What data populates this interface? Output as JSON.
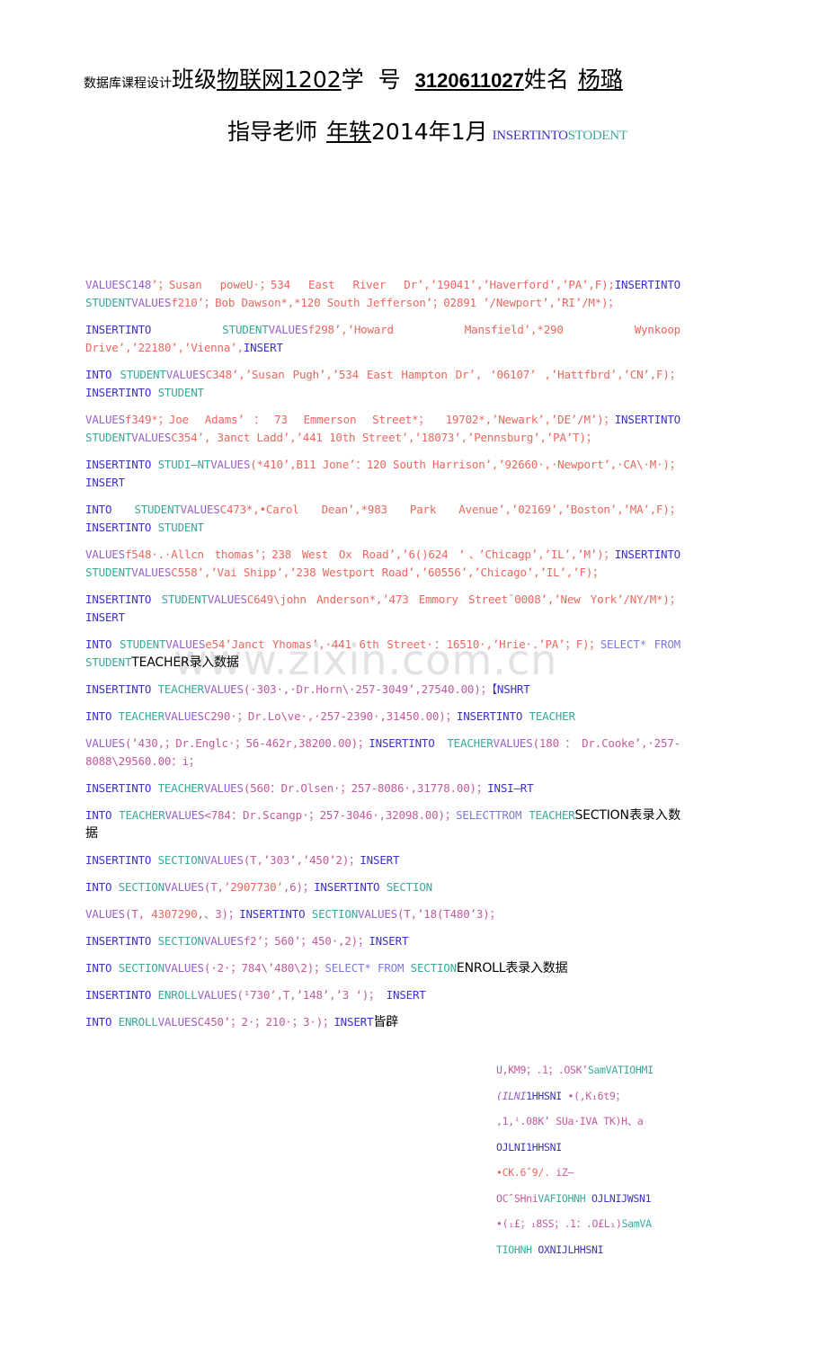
{
  "document": {
    "watermark": "www.zixin.com.cn",
    "colors": {
      "insert_keyword": "#3a33c4",
      "table_name": "#3aa89a",
      "values_keyword": "#9a5fc7",
      "student_data": "#e8685f",
      "teacher_data": "#c15a9e",
      "select_keyword": "#7b7bd8",
      "chinese_text": "#000000",
      "watermark": "#e2e2e6"
    }
  },
  "header": {
    "course_label": "数据库课程设计",
    "class_label": "班级",
    "class_value": "物联网1202",
    "student_id_label_1": "学",
    "student_id_label_2": "号",
    "student_id_value": "3120611027",
    "name_label": "姓名",
    "name_value": "杨璐",
    "advisor_label": "指导老师",
    "advisor_value": "年轶",
    "date_value": "2014年1月",
    "trailing_text": "INSERT INTO STODENT"
  },
  "sql_lines": [
    {
      "id": "line-1",
      "segments": [
        {
          "text": "VALUESC148",
          "style": "val"
        },
        {
          "text": "’；Susan poweU·；534 East River Dr’,’19041’,’Haverford’,’PA’,F)",
          "style": "dat"
        },
        {
          "text": ";",
          "style": "dat"
        },
        {
          "text": "INSERTINTO",
          "style": "ins"
        },
        {
          "text": " ",
          "style": "plain"
        },
        {
          "text": "STUDENT",
          "style": "tbl"
        },
        {
          "text": "VALUES",
          "style": "val"
        },
        {
          "text": "f210’；Bob Dawson*,*120 South Jefferson’；02891 ’/Newport’,’RI’/M*)；",
          "style": "dat"
        }
      ]
    },
    {
      "id": "line-2",
      "segments": [
        {
          "text": "INSERTINTO",
          "style": "ins"
        },
        {
          "text": "            ",
          "style": "plain"
        },
        {
          "text": "STUDENT",
          "style": "tbl"
        },
        {
          "text": "VALUES",
          "style": "val"
        },
        {
          "text": "f298’,’Howard          Mansfield’,*290        Wynkoop Drive’,’22180’,’Vienna’,",
          "style": "dat"
        },
        {
          "text": "INSERT",
          "style": "ins"
        }
      ]
    },
    {
      "id": "line-3",
      "segments": [
        {
          "text": "INTO",
          "style": "ins"
        },
        {
          "text": "          ",
          "style": "plain"
        },
        {
          "text": "STUDENT",
          "style": "tbl"
        },
        {
          "text": "VALUES",
          "style": "val"
        },
        {
          "text": "C348’,’Susan          Pugh’,’534        East        Hampton Dr’, ‘06107’ ,’Hattfbrd’,’CN’,F)；",
          "style": "dat"
        },
        {
          "text": "INSERTINTO",
          "style": "ins"
        },
        {
          "text": " ",
          "style": "plain"
        },
        {
          "text": "STUDENT",
          "style": "tbl"
        }
      ]
    },
    {
      "id": "line-4",
      "segments": [
        {
          "text": "VALUES",
          "style": "val"
        },
        {
          "text": "f349*；Joe Adams’：73 Emmerson Street*； 19702*,’Newark’,’DE’/M’)；",
          "style": "dat"
        },
        {
          "text": "INSERTINTO",
          "style": "ins"
        },
        {
          "text": " ",
          "style": "plain"
        },
        {
          "text": "STUDENT",
          "style": "tbl"
        },
        {
          "text": "VALUES",
          "style": "val"
        },
        {
          "text": "C354’, 3anct Ladd’,’441 10th Street’,’18073’,’Pennsburg’,’PA’T)；",
          "style": "dat"
        }
      ]
    },
    {
      "id": "line-5",
      "segments": [
        {
          "text": "INSERTINTO",
          "style": "ins"
        },
        {
          "text": "                  ",
          "style": "plain"
        },
        {
          "text": "STUDI–NT",
          "style": "tbl"
        },
        {
          "text": "VALUES",
          "style": "val"
        },
        {
          "text": "(*410’,B11              Jone’：120        South Harrison’,’92660·,·Newport’,·CA\\·M·)；",
          "style": "dat"
        },
        {
          "text": "INSERT",
          "style": "ins"
        }
      ]
    },
    {
      "id": "line-6",
      "segments": [
        {
          "text": "INTO",
          "style": "ins"
        },
        {
          "text": "               ",
          "style": "plain"
        },
        {
          "text": "STUDENT",
          "style": "tbl"
        },
        {
          "text": "VALUES",
          "style": "val"
        },
        {
          "text": "C473*,•Carol            Dean’,*983          Park Avenue’,’02169’,’Boston’,’MA’,F)；",
          "style": "dat"
        },
        {
          "text": "INSERTINTO",
          "style": "ins"
        },
        {
          "text": " ",
          "style": "plain"
        },
        {
          "text": "STUDENT",
          "style": "tbl"
        }
      ]
    },
    {
      "id": "line-7",
      "segments": [
        {
          "text": "VALUES",
          "style": "val"
        },
        {
          "text": "f548·.·Allcn thomas’；238 West Ox Road’,’6()624 ‘、’Chicagp’,’IL’,’M’)；",
          "style": "dat"
        },
        {
          "text": "INSERTINTO",
          "style": "ins"
        },
        {
          "text": " ",
          "style": "plain"
        },
        {
          "text": "STUDENT",
          "style": "tbl"
        },
        {
          "text": "VALUES",
          "style": "val"
        },
        {
          "text": "C558’,’Vai Shipp’,’238 Westport Road’,’60556’,’Chicago’,’IL’,’F)；",
          "style": "dat"
        }
      ]
    },
    {
      "id": "line-8",
      "segments": [
        {
          "text": "INSERTINTO",
          "style": "ins"
        },
        {
          "text": "   ",
          "style": "plain"
        },
        {
          "text": "STUDENT",
          "style": "tbl"
        },
        {
          "text": "VALUES",
          "style": "val"
        },
        {
          "text": "C649\\john      Anderson*,’473     Emmory     Street¯0008’,’New York’/NY/M*)；",
          "style": "dat"
        },
        {
          "text": "INSERT",
          "style": "ins"
        }
      ]
    },
    {
      "id": "line-9",
      "segments": [
        {
          "text": "INTO",
          "style": "ins"
        },
        {
          "text": " ",
          "style": "plain"
        },
        {
          "text": "STUDENT",
          "style": "tbl"
        },
        {
          "text": "VALUES",
          "style": "val"
        },
        {
          "text": "e54’Janct Yhomas’,·441 6th Street·：16510·,’Hrie·.’PA’；F)；",
          "style": "dat"
        },
        {
          "text": "SELECT* FROM",
          "style": "sel"
        },
        {
          "text": " ",
          "style": "plain"
        },
        {
          "text": "STUDENT",
          "style": "tbl"
        },
        {
          "text": "TEACHER",
          "style": "blk"
        },
        {
          "text": "录入数据",
          "style": "blk"
        }
      ]
    },
    {
      "id": "line-10",
      "segments": [
        {
          "text": "INSERTINTO",
          "style": "ins"
        },
        {
          "text": " ",
          "style": "plain"
        },
        {
          "text": "TEACHER",
          "style": "tbl"
        },
        {
          "text": "VALUES",
          "style": "val"
        },
        {
          "text": "(·303·,·Dr.Horn\\·257-3049’,27540.00)；",
          "style": "dat2"
        },
        {
          "text": "【NSHRT",
          "style": "ins"
        }
      ]
    },
    {
      "id": "line-11",
      "segments": [
        {
          "text": "INTO",
          "style": "ins"
        },
        {
          "text": " ",
          "style": "plain"
        },
        {
          "text": "TEACHER",
          "style": "tbl"
        },
        {
          "text": "VALUES",
          "style": "val"
        },
        {
          "text": "C290·；Dr.Lo\\ve·,·257-2390·,31450.00)；",
          "style": "dat2"
        },
        {
          "text": "INSERTINTO",
          "style": "ins"
        },
        {
          "text": " ",
          "style": "plain"
        },
        {
          "text": "TEACHER",
          "style": "tbl"
        }
      ]
    },
    {
      "id": "line-12",
      "segments": [
        {
          "text": "VALUES",
          "style": "val"
        },
        {
          "text": "(’430,；Dr.Englc·；56-462r,38200.00)；",
          "style": "dat2"
        },
        {
          "text": "INSERTINTO",
          "style": "ins"
        },
        {
          "text": " ",
          "style": "plain"
        },
        {
          "text": "TEACHER",
          "style": "tbl"
        },
        {
          "text": "VALUES",
          "style": "val"
        },
        {
          "text": "(180：Dr.Cooke’,·257-8088\\29560.00：i；",
          "style": "dat2"
        }
      ]
    },
    {
      "id": "line-13",
      "segments": [
        {
          "text": "INSERTINTO",
          "style": "ins"
        },
        {
          "text": " ",
          "style": "plain"
        },
        {
          "text": "TEACHER",
          "style": "tbl"
        },
        {
          "text": "VALUES",
          "style": "val"
        },
        {
          "text": "(560：Dr.Olsen·；257-8086·,31778.00)；",
          "style": "dat2"
        },
        {
          "text": "INSI–RT",
          "style": "ins"
        }
      ]
    },
    {
      "id": "line-14",
      "segments": [
        {
          "text": "INTO",
          "style": "ins"
        },
        {
          "text": " ",
          "style": "plain"
        },
        {
          "text": "TEACHER",
          "style": "tbl"
        },
        {
          "text": "VALUES",
          "style": "val"
        },
        {
          "text": "<784：Dr.Scangp·；257-3046·,32098.00)；",
          "style": "dat2"
        },
        {
          "text": "SELECTTROM",
          "style": "sel"
        },
        {
          "text": " ",
          "style": "plain"
        },
        {
          "text": "TEACHER",
          "style": "tbl"
        },
        {
          "text": "SECTION",
          "style": "blk"
        },
        {
          "text": "表录入数据",
          "style": "blk"
        }
      ]
    },
    {
      "id": "line-15",
      "segments": [
        {
          "text": "INSERTINTO",
          "style": "ins"
        },
        {
          "text": " ",
          "style": "plain"
        },
        {
          "text": "SECTION",
          "style": "tbl"
        },
        {
          "text": "VALUES",
          "style": "val"
        },
        {
          "text": "(T,’303’,’450’2)；",
          "style": "dat2"
        },
        {
          "text": "INSERT",
          "style": "ins"
        }
      ]
    },
    {
      "id": "line-16",
      "segments": [
        {
          "text": "INTO",
          "style": "ins"
        },
        {
          "text": " ",
          "style": "plain"
        },
        {
          "text": "SECTION",
          "style": "tbl"
        },
        {
          "text": "VALUES",
          "style": "val"
        },
        {
          "text": "(T,",
          "style": "dat2"
        },
        {
          "text": "’2907730’",
          "style": "dat"
        },
        {
          "text": ",6)；",
          "style": "dat2"
        },
        {
          "text": "INSERTINTO",
          "style": "ins"
        },
        {
          "text": " ",
          "style": "plain"
        },
        {
          "text": "SECTION",
          "style": "tbl"
        }
      ]
    },
    {
      "id": "line-17",
      "segments": [
        {
          "text": "VALUES",
          "style": "val"
        },
        {
          "text": "(T, ",
          "style": "dat2"
        },
        {
          "text": "4307290,",
          "style": "dat"
        },
        {
          "text": "、3)；",
          "style": "dat2"
        },
        {
          "text": "INSERTINTO",
          "style": "ins"
        },
        {
          "text": " ",
          "style": "plain"
        },
        {
          "text": "SECTION",
          "style": "tbl"
        },
        {
          "text": "VALUES",
          "style": "val"
        },
        {
          "text": "(T,’18(T480’3)；",
          "style": "dat2"
        }
      ]
    },
    {
      "id": "line-18",
      "segments": [
        {
          "text": "INSERTINTO",
          "style": "ins"
        },
        {
          "text": " ",
          "style": "plain"
        },
        {
          "text": "SECTION",
          "style": "tbl"
        },
        {
          "text": "VALUES",
          "style": "val"
        },
        {
          "text": "f2’；560’；450·,2)；",
          "style": "dat2"
        },
        {
          "text": "INSERT",
          "style": "ins"
        }
      ]
    },
    {
      "id": "line-19",
      "segments": [
        {
          "text": "INTO",
          "style": "ins"
        },
        {
          "text": " ",
          "style": "plain"
        },
        {
          "text": "SECTION",
          "style": "tbl"
        },
        {
          "text": "VALUES",
          "style": "val"
        },
        {
          "text": "(·2·；784\\’480\\2)；",
          "style": "dat2"
        },
        {
          "text": "SELECT* FROM",
          "style": "sel"
        },
        {
          "text": " ",
          "style": "plain"
        },
        {
          "text": "SECTION",
          "style": "tbl"
        },
        {
          "text": "ENROLL",
          "style": "blk"
        },
        {
          "text": "表录入数据",
          "style": "blk"
        }
      ]
    },
    {
      "id": "line-20",
      "segments": [
        {
          "text": "INSERTINTO",
          "style": "ins"
        },
        {
          "text": " ",
          "style": "plain"
        },
        {
          "text": "ENROLL",
          "style": "tbl"
        },
        {
          "text": "VALUES",
          "style": "val"
        },
        {
          "text": "(¹730’,T,’148’,’3 ‘)； ",
          "style": "dat2"
        },
        {
          "text": "INSERT",
          "style": "ins"
        }
      ]
    },
    {
      "id": "line-21",
      "segments": [
        {
          "text": "INTO",
          "style": "ins"
        },
        {
          "text": " ",
          "style": "plain"
        },
        {
          "text": "ENROLL",
          "style": "tbl"
        },
        {
          "text": "VALUES",
          "style": "val"
        },
        {
          "text": "C450’；2·；210·；3·)；",
          "style": "dat2"
        },
        {
          "text": "INSERT",
          "style": "ins"
        },
        {
          "text": "皆辟",
          "style": "blk"
        }
      ]
    }
  ],
  "garbled_block": [
    {
      "id": "g-line-1",
      "segments": [
        {
          "text": "U,KM9；.1；.OSK’",
          "style": "dat2"
        },
        {
          "text": "SamVATIOHMI",
          "style": "tbl"
        }
      ]
    },
    {
      "id": "g-line-2",
      "segments": [
        {
          "text": " ",
          "style": "plain"
        },
        {
          "text": "(ILNI",
          "style": "val-it"
        },
        {
          "text": "1HHSNI",
          "style": "ins"
        },
        {
          "text": "        ",
          "style": "plain"
        },
        {
          "text": "•(,K",
          "style": "dat2"
        },
        {
          "text": "₁",
          "style": "dat2"
        },
        {
          "text": "6t9；",
          "style": "dat2"
        }
      ]
    },
    {
      "id": "g-line-3",
      "segments": [
        {
          "text": ",1,ⁱ.08K’ SUa·IVA",
          "style": "dat2"
        },
        {
          "text": "    ",
          "style": "plain"
        },
        {
          "text": "TK)H、a",
          "style": "dat2"
        }
      ]
    },
    {
      "id": "g-line-4",
      "segments": [
        {
          "text": "OJLNI1HHSNI",
          "style": "ins"
        }
      ]
    },
    {
      "id": "g-line-5",
      "segments": [
        {
          "text": "•CK.6ˆ9/.",
          "style": "dat"
        },
        {
          "text": "              ",
          "style": "plain"
        },
        {
          "text": "iZ–",
          "style": "dat2"
        }
      ]
    },
    {
      "id": "g-line-6",
      "segments": [
        {
          "text": "OCˆSHni",
          "style": "dat2"
        },
        {
          "text": "VAFIOHNH",
          "style": "tbl"
        },
        {
          "text": " ",
          "style": "plain"
        },
        {
          "text": "OJLNIJWSN1",
          "style": "ins"
        }
      ]
    },
    {
      "id": "g-line-7",
      "segments": [
        {
          "text": "•(₁£；₁8SS；.1：.O£L₁)",
          "style": "dat2"
        },
        {
          "text": "SamVA",
          "style": "tbl"
        }
      ]
    },
    {
      "id": "g-line-8",
      "segments": [
        {
          "text": "TIOHNH",
          "style": "tbl"
        },
        {
          "text": " ",
          "style": "plain"
        },
        {
          "text": "OXNIJLHHSNI",
          "style": "ins"
        }
      ]
    }
  ]
}
